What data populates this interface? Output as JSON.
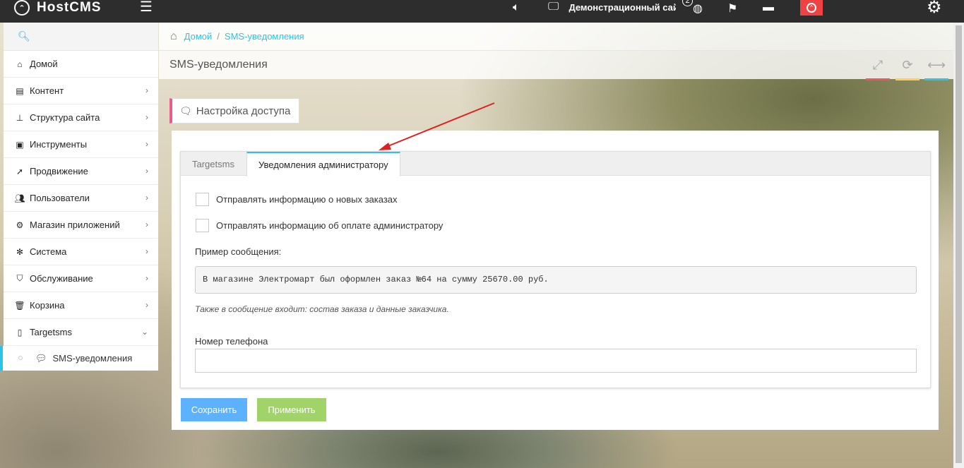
{
  "navbar": {
    "logo_text": "HostCMS",
    "site_name": "Демонстрационный сайт",
    "notification_count": "2",
    "menu_icon": "hamburger-icon",
    "sound_icon": "volume-icon",
    "monitor_icon": "monitor-icon",
    "globe_icon": "globe-icon",
    "flag_icon": "flag-icon",
    "chat_icon": "chat-icon",
    "alert_icon": "alert-circle-icon",
    "settings_icon": "gear-icon",
    "accent_red": "#ef4343"
  },
  "sidebar": {
    "search_icon": "search-icon",
    "items": [
      {
        "label": "Домой",
        "icon": "home-icon",
        "has_children": false
      },
      {
        "label": "Контент",
        "icon": "newspaper-icon",
        "has_children": true
      },
      {
        "label": "Структура сайта",
        "icon": "sitemap-icon",
        "has_children": true
      },
      {
        "label": "Инструменты",
        "icon": "briefcase-icon",
        "has_children": true
      },
      {
        "label": "Продвижение",
        "icon": "rocket-icon",
        "has_children": true
      },
      {
        "label": "Пользователи",
        "icon": "users-icon",
        "has_children": true
      },
      {
        "label": "Магазин приложений",
        "icon": "cogs-icon",
        "has_children": true
      },
      {
        "label": "Система",
        "icon": "gear-icon",
        "has_children": true
      },
      {
        "label": "Обслуживание",
        "icon": "shield-icon",
        "has_children": true
      },
      {
        "label": "Корзина",
        "icon": "trash-icon",
        "has_children": true
      },
      {
        "label": "Targetsms",
        "icon": "mobile-icon",
        "has_children": true,
        "expanded": true
      }
    ],
    "sub_item": {
      "label": "SMS-уведомления",
      "icon": "comment-icon",
      "active": true
    },
    "accent": "#2dc3e8"
  },
  "breadcrumb": {
    "home": "Домой",
    "separator": "/",
    "current": "SMS-уведомления"
  },
  "page": {
    "title": "SMS-уведомления",
    "header_buttons": [
      {
        "icon": "fullscreen-icon",
        "color": "#e75b5b"
      },
      {
        "icon": "refresh-icon",
        "color": "#ffce55"
      },
      {
        "icon": "expand-horizontal-icon",
        "color": "#2dc3e8"
      }
    ]
  },
  "access_button": {
    "label": "Настройка доступа",
    "icon": "comment-icon"
  },
  "tabs": [
    {
      "label": "Targetsms",
      "active": false
    },
    {
      "label": "Уведомления администратору",
      "active": true
    }
  ],
  "form": {
    "checkbox_new_orders": {
      "label": "Отправлять информацию о новых заказах",
      "checked": false
    },
    "checkbox_payment": {
      "label": "Отправлять информацию об оплате администратору",
      "checked": false
    },
    "example_label": "Пример сообщения:",
    "example_text": "В магазине Электромарт был оформлен заказ №64 на сумму 25670.00 руб.",
    "hint": "Также в сообщение входит: состав заказа и данные заказчика.",
    "phone_label": "Номер телефона",
    "phone_value": ""
  },
  "buttons": {
    "save": "Сохранить",
    "apply": "Применить"
  }
}
